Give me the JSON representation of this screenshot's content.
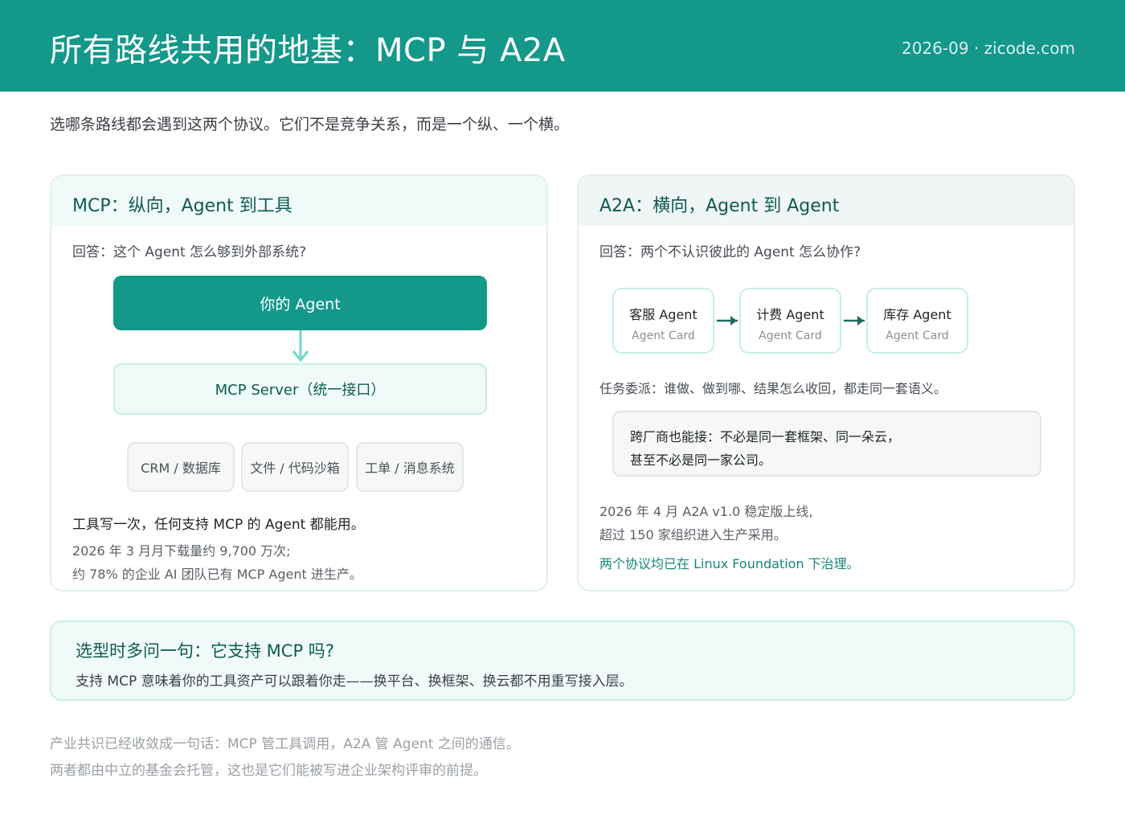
{
  "header": {
    "title": "所有路线共用的地基：MCP 与 A2A",
    "meta": "2026-09 · zicode.com"
  },
  "intro": "选哪条路线都会遇到这两个协议。它们不是竞争关系，而是一个纵、一个横。",
  "mcp": {
    "title": "MCP：纵向，Agent 到工具",
    "question": "回答：这个 Agent 怎么够到外部系统?",
    "agent_label": "你的 Agent",
    "server_label": "MCP Server（统一接口）",
    "tools": [
      "CRM / 数据库",
      "文件 / 代码沙箱",
      "工单 / 消息系统"
    ],
    "strong": "工具写一次，任何支持 MCP 的 Agent 都能用。",
    "stats": [
      "2026 年 3 月月下载量约 9,700 万次;",
      "约 78% 的企业 AI 团队已有 MCP Agent 进生产。"
    ]
  },
  "a2a": {
    "title": "A2A：横向，Agent 到 Agent",
    "question": "回答：两个不认识彼此的 Agent 怎么协作?",
    "peers": [
      {
        "name": "客服 Agent",
        "card": "Agent Card"
      },
      {
        "name": "计费 Agent",
        "card": "Agent Card"
      },
      {
        "name": "库存 Agent",
        "card": "Agent Card"
      }
    ],
    "task": "任务委派：谁做、做到哪、结果怎么收回，都走同一套语义。",
    "note": [
      "跨厂商也能接：不必是同一套框架、同一朵云，",
      "甚至不必是同一家公司。"
    ],
    "stats": [
      "2026 年 4 月 A2A v1.0 稳定版上线,",
      "超过 150 家组织进入生产采用。"
    ],
    "governance": "两个协议均已在 Linux Foundation 下治理。"
  },
  "tip": {
    "title": "选型时多问一句：它支持 MCP 吗?",
    "body": "支持 MCP 意味着你的工具资产可以跟着你走——换平台、换框架、换云都不用重写接入层。"
  },
  "footer": [
    "产业共识已经收敛成一句话：MCP 管工具调用，A2A 管 Agent 之间的通信。",
    "两者都由中立的基金会托管，这也是它们能被写进企业架构评审的前提。"
  ],
  "colors": {
    "brand": "#13988a",
    "brand_dark": "#0e5a52",
    "arrow": "#6fd9c8",
    "peer_arrow": "#1e6b63"
  }
}
